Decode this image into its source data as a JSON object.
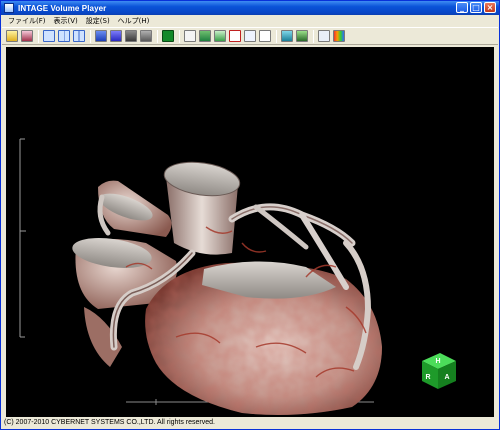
{
  "window": {
    "title": "INTAGE Volume Player"
  },
  "title_buttons": {
    "minimize": "_",
    "maximize": "□",
    "close": "×"
  },
  "menu": [
    {
      "label": "ファイル(F)"
    },
    {
      "label": "表示(V)"
    },
    {
      "label": "設定(S)"
    },
    {
      "label": "ヘルプ(H)"
    }
  ],
  "toolbar": {
    "icons": [
      "open-folder-icon",
      "save-image-icon",
      "layout-single-icon",
      "layout-split-icon",
      "layout-quad-icon",
      "render-mode-1-icon",
      "render-mode-2-icon",
      "render-mode-3-icon",
      "render-mode-4-icon",
      "green-square-icon",
      "preset-1-icon",
      "preset-2-icon",
      "preset-3-icon",
      "axes-icon",
      "crop-icon",
      "blank-icon",
      "cube-icon",
      "person-icon",
      "window-icon",
      "palette-icon"
    ]
  },
  "orientation_cube": {
    "top": "H",
    "left": "R",
    "right": "A",
    "color": "#1fa02a"
  },
  "status": {
    "copyright": "(C) 2007-2010 CYBERNET SYSTEMS CO.,LTD. All rights reserved."
  }
}
